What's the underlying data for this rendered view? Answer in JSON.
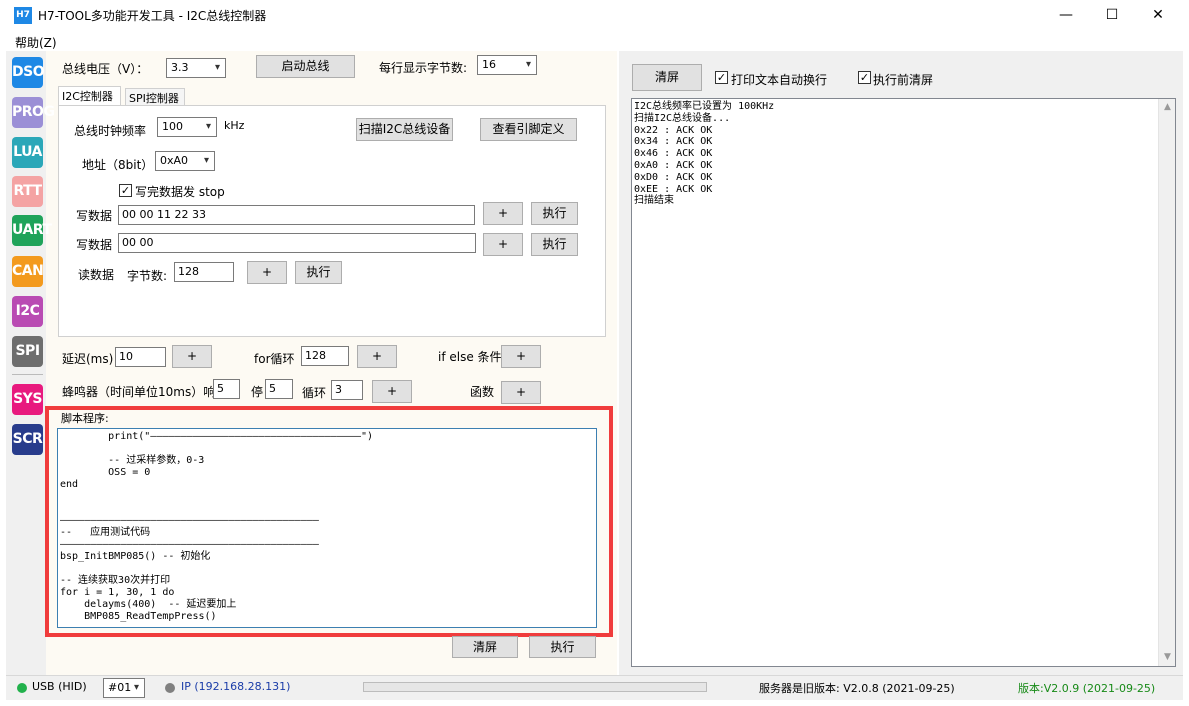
{
  "window": {
    "icon_text": "H7",
    "title": "H7-TOOL多功能开发工具 - I2C总线控制器",
    "minimize": "—",
    "maximize": "☐",
    "close": "✕"
  },
  "menu": {
    "help": "帮助(Z)"
  },
  "sidebar": {
    "items": [
      {
        "label": "DSO",
        "color": "#1e88e5"
      },
      {
        "label": "PROG",
        "color": "#9b8fd6"
      },
      {
        "label": "LUA",
        "color": "#2ba7b8"
      },
      {
        "label": "RTT",
        "color": "#f4a3a3"
      },
      {
        "label": "UART",
        "color": "#1fa35a"
      },
      {
        "label": "CAN",
        "color": "#f39a1e"
      },
      {
        "label": "I2C",
        "color": "#b94bb3"
      },
      {
        "label": "SPI",
        "color": "#6e6e6e"
      },
      {
        "label": "SYS",
        "color": "#e8197e"
      },
      {
        "label": "SCR",
        "color": "#283c8c"
      }
    ]
  },
  "top": {
    "voltage_label": "总线电压（V）：",
    "voltage_value": "3.3",
    "start_bus": "启动总线",
    "bytes_per_line_label": "每行显示字节数:",
    "bytes_per_line_value": "16"
  },
  "tabs": {
    "i2c": "I2C控制器",
    "spi": "SPI控制器"
  },
  "i2c": {
    "clock_label": "总线时钟频率",
    "clock_value": "100",
    "clock_unit": "kHz",
    "scan_button": "扫描I2C总线设备",
    "pin_button": "查看引脚定义",
    "addr_label": "地址（8bit）",
    "addr_value": "0xA0",
    "stop_check_label": "写完数据发 stop",
    "write1_label": "写数据",
    "write1_value": "00 00 11 22 33",
    "write2_label": "写数据",
    "write2_value": "00 00",
    "read_label": "读数据",
    "read_bytes_label": "字节数:",
    "read_bytes_value": "128",
    "plus": "+",
    "exec": "执行"
  },
  "misc": {
    "delay_label": "延迟(ms)",
    "delay_value": "10",
    "for_label": "for循环",
    "for_value": "128",
    "ifelse_label": "if else 条件",
    "buzzer_label": "蜂鸣器（时间单位10ms）响",
    "buzzer_on_value": "5",
    "stop_label": "停",
    "stop_value": "5",
    "loop_label": "循环",
    "loop_value": "3",
    "func_label": "函数",
    "plus": "+"
  },
  "script": {
    "title": "脚本程序:",
    "code": "        print(\"———————————————————————————————————\")\n\n        -- 过采样参数，0-3\n        OSS = 0\nend\n\n\n———————————————————————————————————————————\n--   应用测试代码\n———————————————————————————————————————————\nbsp_InitBMP085() -- 初始化\n\n-- 连续获取30次并打印\nfor i = 1, 30, 1 do\n    delayms(400)  -- 延迟要加上\n    BMP085_ReadTempPress()",
    "clear": "清屏",
    "exec": "执行"
  },
  "log": {
    "clear": "清屏",
    "auto_wrap": "打印文本自动换行",
    "clear_before": "执行前清屏",
    "text": "I2C总线频率已设置为 100KHz\n扫描I2C总线设备...\n0x22 : ACK OK\n0x34 : ACK OK\n0x46 : ACK OK\n0xA0 : ACK OK\n0xD0 : ACK OK\n0xEE : ACK OK\n扫描结束"
  },
  "status": {
    "usb": "USB (HID)",
    "usb_color": "#22b14c",
    "device": "#01",
    "ip": "IP (192.168.28.131)",
    "ip_color": "#808080",
    "server": "服务器是旧版本: V2.0.8 (2021-09-25)",
    "version": "版本:V2.0.9 (2021-09-25)",
    "version_color": "#178a17",
    "ip_text_color": "#1a3ca8"
  }
}
